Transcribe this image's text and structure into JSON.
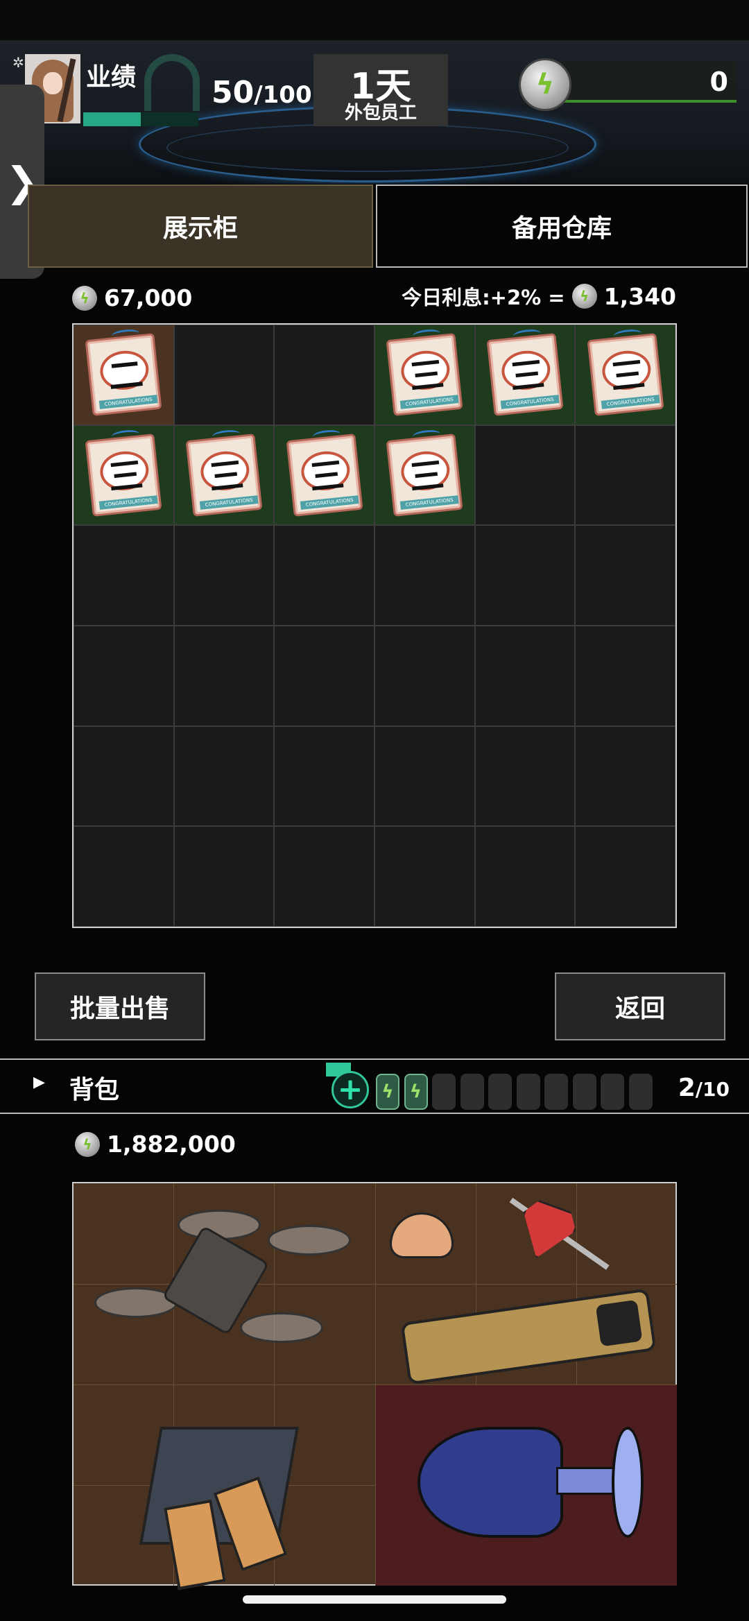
{
  "header": {
    "perf_label": "业绩",
    "perf_current": "50",
    "perf_total": "/100",
    "perf_progress": 0.5,
    "day_value": "1天",
    "day_label": "外包员工",
    "energy_value": "0",
    "side_toggle": "❯"
  },
  "tabs": {
    "display": "展示柜",
    "storage": "备用仓库"
  },
  "cabinet": {
    "money": "67,000",
    "interest_label": "今日利息:+2% =",
    "interest_value": "1,340",
    "items": [
      {
        "text": "二",
        "bg": "brown"
      },
      {
        "text": "",
        "bg": "empty"
      },
      {
        "text": "",
        "bg": "empty"
      },
      {
        "text": "三",
        "bg": "green"
      },
      {
        "text": "三",
        "bg": "green"
      },
      {
        "text": "三",
        "bg": "green"
      },
      {
        "text": "三",
        "bg": "green"
      },
      {
        "text": "三",
        "bg": "green"
      },
      {
        "text": "三",
        "bg": "green"
      },
      {
        "text": "三",
        "bg": "green"
      }
    ],
    "ticket_caption": "CONGRATULATIONS"
  },
  "buttons": {
    "bulk_sell": "批量出售",
    "back": "返回"
  },
  "backpack": {
    "title": "背包",
    "count_current": "2",
    "count_total": "/10",
    "money": "1,882,000",
    "slots_filled": 2,
    "slots_total": 10
  },
  "colors": {
    "accent_green": "#26a884",
    "tab_active": "#3b3426",
    "cell_green": "#1e3b1e",
    "cell_brown": "#4a3320",
    "pack_bg": "#4a3220",
    "rare_bg": "#4c1c1f"
  }
}
